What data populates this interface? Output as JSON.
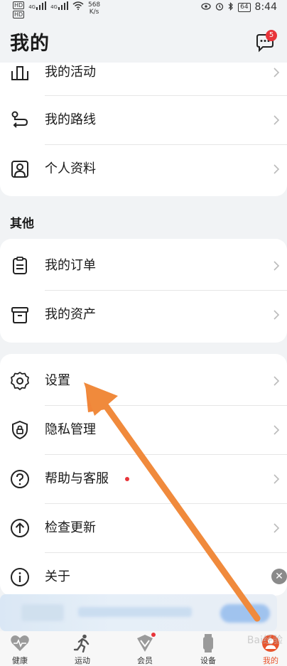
{
  "status_bar": {
    "hd1": "HD",
    "hd2": "HD",
    "net1": "4G",
    "net2": "4G",
    "speed_value": "568",
    "speed_unit": "K/s",
    "battery": "64",
    "time": "8:44"
  },
  "header": {
    "title": "我的",
    "message_badge": "5"
  },
  "group1": {
    "items": [
      {
        "label": "我的活动"
      },
      {
        "label": "我的路线"
      },
      {
        "label": "个人资料"
      }
    ]
  },
  "section_other": {
    "title": "其他",
    "items": [
      {
        "label": "我的订单"
      },
      {
        "label": "我的资产"
      }
    ]
  },
  "group3": {
    "items": [
      {
        "label": "设置"
      },
      {
        "label": "隐私管理"
      },
      {
        "label": "帮助与客服"
      },
      {
        "label": "检查更新"
      },
      {
        "label": "关于"
      }
    ]
  },
  "tabbar": {
    "tabs": [
      {
        "label": "健康"
      },
      {
        "label": "运动"
      },
      {
        "label": "会员"
      },
      {
        "label": "设备"
      },
      {
        "label": "我的"
      }
    ]
  },
  "watermark": "Bai经验",
  "colors": {
    "accent": "#e8542d",
    "badge": "#e8343a",
    "arrow": "#f08a3c",
    "background": "#f1f3f5"
  }
}
